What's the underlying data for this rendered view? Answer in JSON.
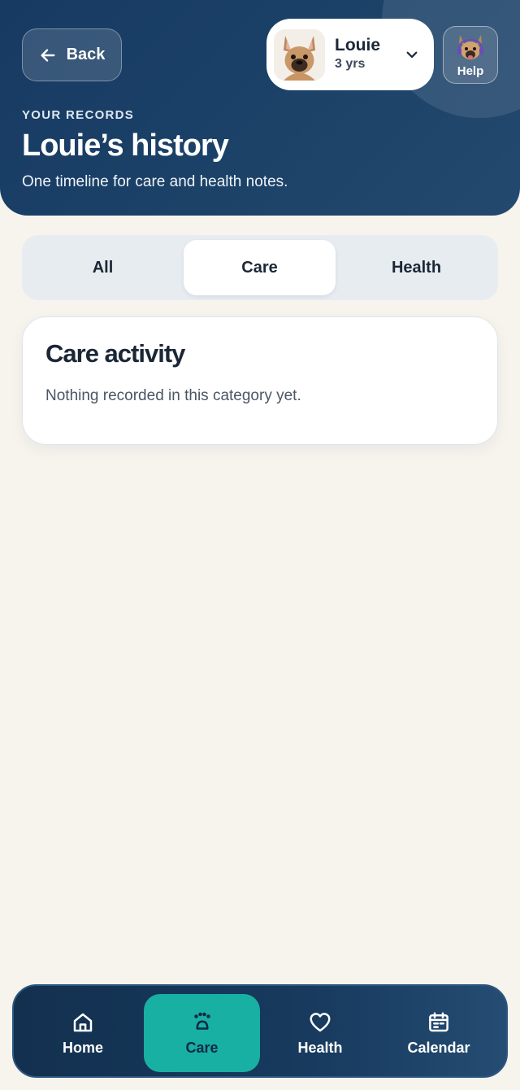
{
  "header": {
    "back_label": "Back",
    "pet": {
      "name": "Louie",
      "age": "3 yrs"
    },
    "help_label": "Help",
    "eyebrow": "YOUR RECORDS",
    "title": "Louie’s history",
    "subtitle": "One timeline for care and health notes."
  },
  "tabs": [
    {
      "label": "All",
      "active": false
    },
    {
      "label": "Care",
      "active": true
    },
    {
      "label": "Health",
      "active": false
    }
  ],
  "card": {
    "title": "Care activity",
    "text": "Nothing recorded in this category yet."
  },
  "nav": [
    {
      "label": "Home",
      "icon": "home-icon",
      "active": false
    },
    {
      "label": "Care",
      "icon": "care-icon",
      "active": true
    },
    {
      "label": "Health",
      "icon": "heart-icon",
      "active": false
    },
    {
      "label": "Calendar",
      "icon": "calendar-icon",
      "active": false
    }
  ],
  "colors": {
    "header_bg": "#1c4268",
    "page_bg": "#f7f4ee",
    "accent_teal": "#18b0a2",
    "nav_bg": "#173a5e"
  }
}
